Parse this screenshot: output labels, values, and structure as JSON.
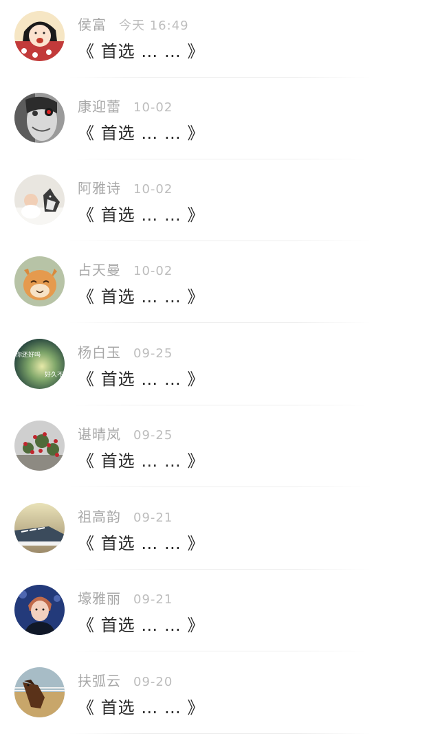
{
  "chats": [
    {
      "name": "侯富",
      "time": "今天 16:49",
      "message": "《 首选 … … 》",
      "avatar_icon": "cartoon-girl-avatar"
    },
    {
      "name": "康迎蕾",
      "time": "10-02",
      "message": "《 首选 … … 》",
      "avatar_icon": "bw-face-avatar"
    },
    {
      "name": "阿雅诗",
      "time": "10-02",
      "message": "《 首选 … … 》",
      "avatar_icon": "baby-and-dog-avatar"
    },
    {
      "name": "占天曼",
      "time": "10-02",
      "message": "《 首选 … … 》",
      "avatar_icon": "smiling-cat-avatar"
    },
    {
      "name": "杨白玉",
      "time": "09-25",
      "message": "《 首选 … … 》",
      "avatar_icon": "text-gradient-avatar",
      "avatar_text": [
        "你还好吗",
        "好久不见"
      ]
    },
    {
      "name": "谌晴岚",
      "time": "09-25",
      "message": "《 首选 … … 》",
      "avatar_icon": "red-flowers-avatar"
    },
    {
      "name": "祖高韵",
      "time": "09-21",
      "message": "《 首选 … … 》",
      "avatar_icon": "sneakers-avatar"
    },
    {
      "name": "壕雅丽",
      "time": "09-21",
      "message": "《 首选 … … 》",
      "avatar_icon": "young-man-avatar"
    },
    {
      "name": "扶弧云",
      "time": "09-20",
      "message": "《 首选 … … 》",
      "avatar_icon": "horse-avatar"
    }
  ]
}
